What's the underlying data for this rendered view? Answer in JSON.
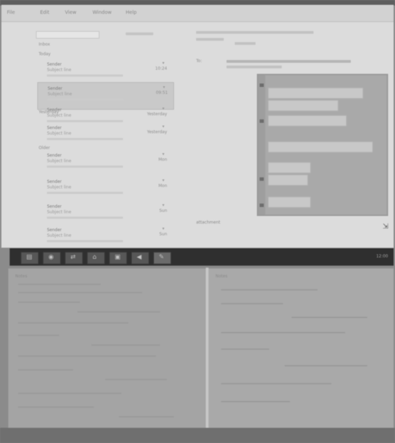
{
  "menubar": {
    "items": [
      "File",
      "Edit",
      "View",
      "Window",
      "Help"
    ]
  },
  "mail": {
    "folder_label": "Inbox",
    "sections": [
      "Today",
      "Yesterday",
      "Older"
    ],
    "messages": [
      {
        "from": "Sender",
        "subject": "Subject line",
        "date": "10:24",
        "selected": false
      },
      {
        "from": "Sender",
        "subject": "Subject line",
        "date": "09:51",
        "selected": true
      },
      {
        "from": "Sender",
        "subject": "Subject line",
        "date": "Yesterday",
        "selected": false
      },
      {
        "from": "Sender",
        "subject": "Subject line",
        "date": "Yesterday",
        "selected": false
      },
      {
        "from": "Sender",
        "subject": "Subject line",
        "date": "Mon",
        "selected": false
      },
      {
        "from": "Sender",
        "subject": "Subject line",
        "date": "Mon",
        "selected": false
      },
      {
        "from": "Sender",
        "subject": "Subject line",
        "date": "Sun",
        "selected": false
      },
      {
        "from": "Sender",
        "subject": "Subject line",
        "date": "Sun",
        "selected": false
      }
    ]
  },
  "preview": {
    "to_label": "To:",
    "link_text": "attachment"
  },
  "taskbar": {
    "buttons": [
      "▤",
      "◉",
      "⇄",
      "⌂",
      "▣",
      "◀",
      "✎"
    ],
    "tray": "12:00"
  },
  "paper_left": {
    "title": "Notes"
  },
  "paper_right": {
    "title": "Notes"
  },
  "colors": {
    "taskbar": "#2f2f2f",
    "screen_bg": "#dcdcdc"
  }
}
